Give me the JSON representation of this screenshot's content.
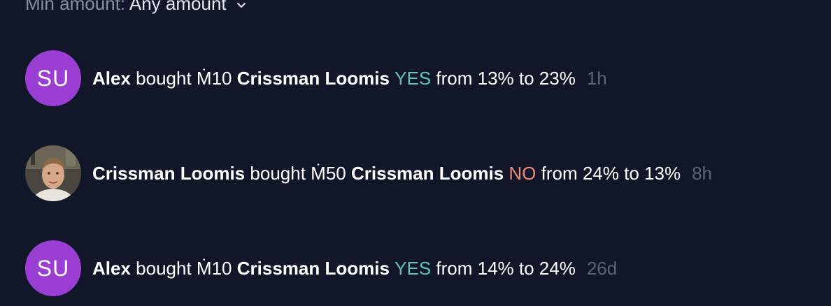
{
  "filter": {
    "label": "Min amount:",
    "value": "Any amount"
  },
  "bets": [
    {
      "avatar_initials": "SU",
      "user": "Alex",
      "verb": "bought",
      "amount": "Ṁ10",
      "market": "Crissman Loomis",
      "outcome": "YES",
      "change": "from 13% to 23%",
      "time": "1h"
    },
    {
      "user": "Crissman Loomis",
      "verb": "bought",
      "amount": "Ṁ50",
      "market": "Crissman Loomis",
      "outcome": "NO",
      "change": "from 24% to 13%",
      "time": "8h"
    },
    {
      "avatar_initials": "SU",
      "user": "Alex",
      "verb": "bought",
      "amount": "Ṁ10",
      "market": "Crissman Loomis",
      "outcome": "YES",
      "change": "from 14% to 24%",
      "time": "26d"
    }
  ],
  "colors": {
    "background": "#111729",
    "yes": "#5fc4b8",
    "no": "#ec8a75",
    "avatar": "#9b3ed3",
    "muted": "#5d6178"
  },
  "icons": {
    "filter_chevron": "chevron-down-icon",
    "photo_avatar": "user-photo-avatar"
  }
}
